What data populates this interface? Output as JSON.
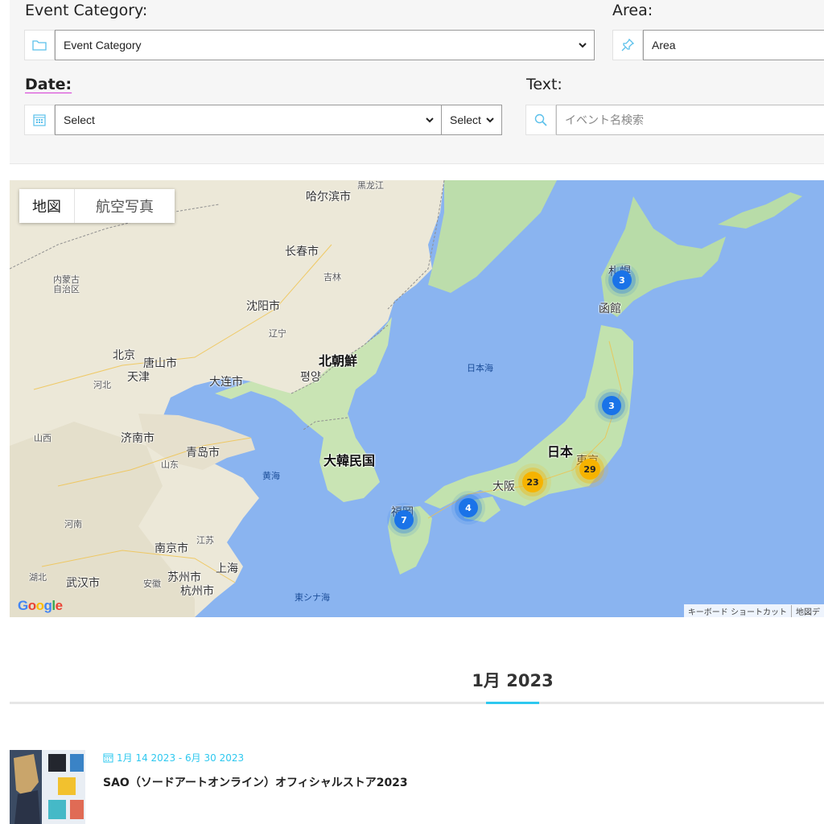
{
  "filters": {
    "category_label": "Event Category:",
    "category_value": "Event Category",
    "area_label": "Area:",
    "area_value": "Area",
    "date_label": "Date:",
    "date_select1": "Select",
    "date_select2": "Select",
    "text_label": "Text:",
    "text_placeholder": "イベント名検索"
  },
  "map": {
    "toggle_map": "地図",
    "toggle_satellite": "航空写真",
    "places": {
      "harbin": "哈尔滨市",
      "heilongjiang": "黑龙江",
      "changchun": "长春市",
      "jilin": "吉林",
      "shenyang": "沈阳市",
      "liaoning": "辽宁",
      "inner_mongolia": "内蒙古\n自治区",
      "beijing": "北京",
      "tangshan": "唐山市",
      "tianjin": "天津",
      "hebei": "河北",
      "dalian": "大连市",
      "north_korea": "北朝鮮",
      "pyongyang": "평양",
      "jinan": "济南市",
      "shanxi": "山西",
      "shandong": "山东",
      "qingdao": "青岛市",
      "henan": "河南",
      "jiangsu": "江苏",
      "hubei": "湖北",
      "nanjing": "南京市",
      "shanghai": "上海",
      "anhui": "安徽",
      "wuhan": "武汉市",
      "suzhou": "苏州市",
      "hangzhou": "杭州市",
      "south_korea": "大韓民国",
      "yellow_sea": "黄海",
      "sea_of_japan": "日本海",
      "east_china_sea": "東シナ海",
      "japan": "日本",
      "sapporo": "札幌",
      "hakodate": "函館",
      "tokyo": "東京",
      "osaka": "大阪",
      "fukuoka": "福岡"
    },
    "clusters": [
      {
        "name": "sapporo",
        "count": "3",
        "color": "#1a73e8"
      },
      {
        "name": "tohoku",
        "count": "3",
        "color": "#1a73e8"
      },
      {
        "name": "tokyo",
        "count": "29",
        "color": "#f6b300"
      },
      {
        "name": "nagoya",
        "count": "23",
        "color": "#f6b300"
      },
      {
        "name": "hiroshima",
        "count": "4",
        "color": "#1a73e8"
      },
      {
        "name": "fukuoka",
        "count": "7",
        "color": "#1a73e8"
      }
    ],
    "google_logo": "Google",
    "attr_shortcuts": "キーボード ショートカット",
    "attr_data": "地図デ"
  },
  "month_heading": "1月 2023",
  "events": [
    {
      "date_range": "1月 14 2023 - 6月 30 2023",
      "title": "SAO（ソードアートオンライン）オフィシャルストア2023"
    }
  ]
}
